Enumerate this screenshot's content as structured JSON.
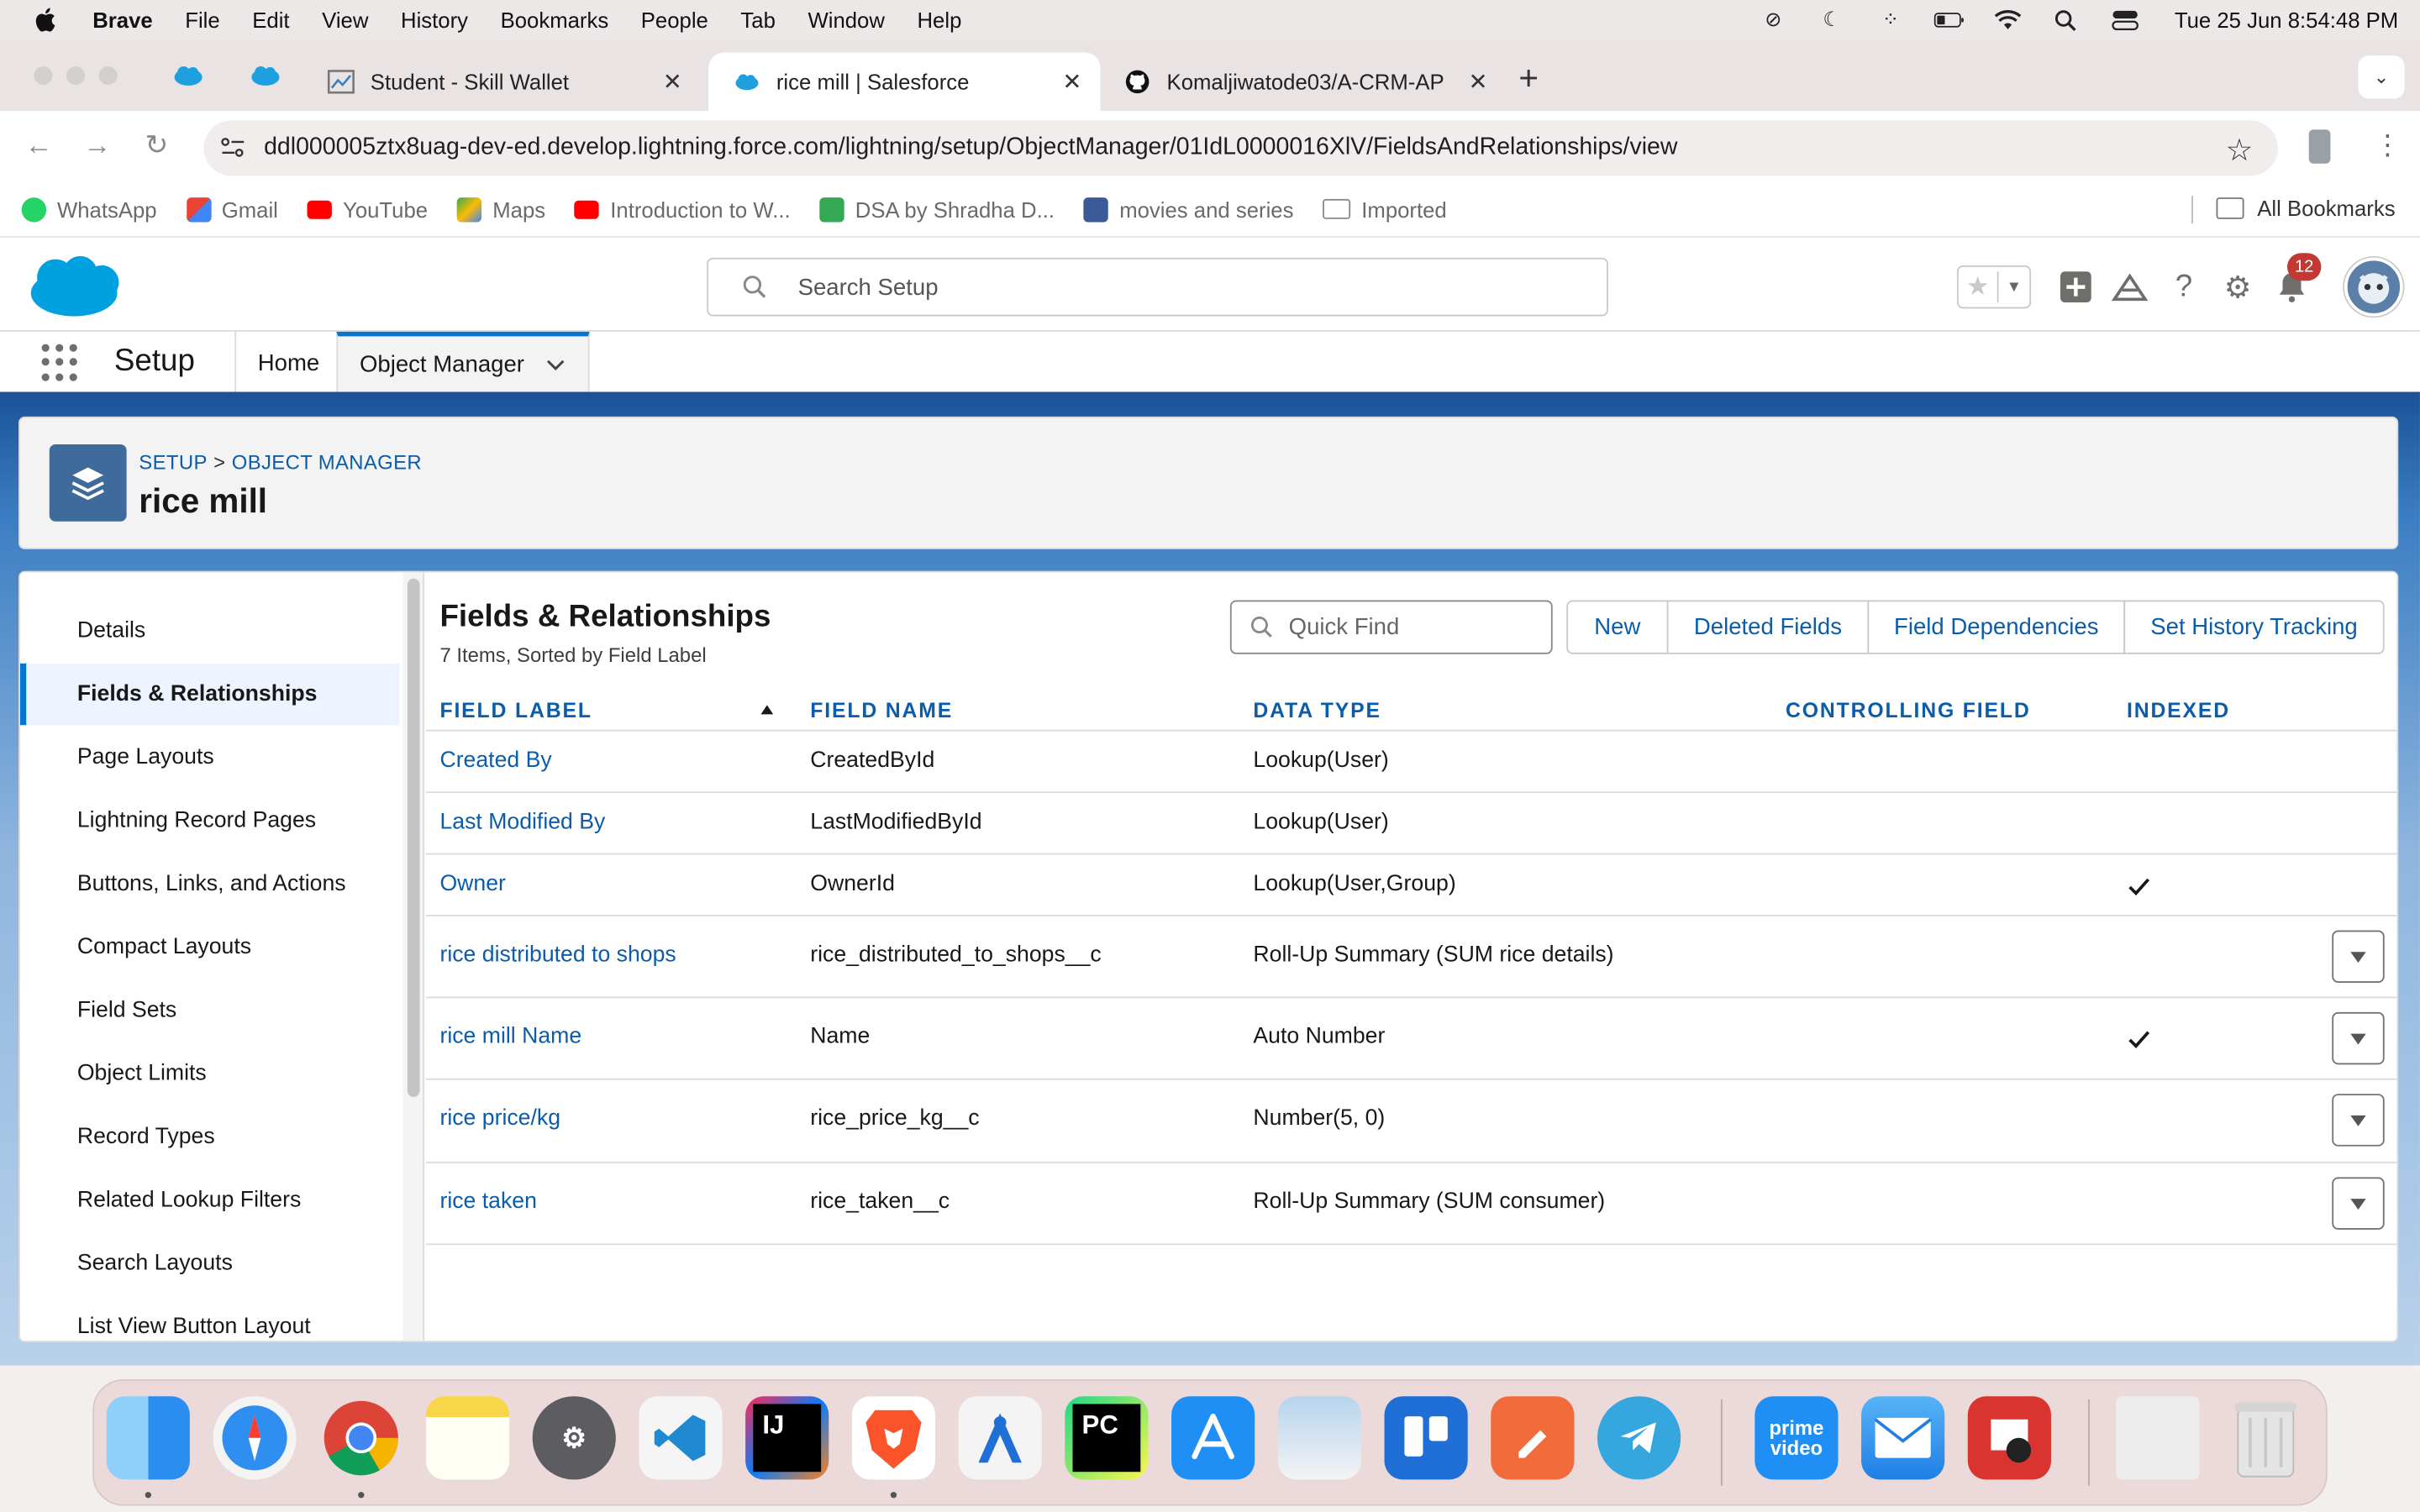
{
  "menubar": {
    "app": "Brave",
    "items": [
      "File",
      "Edit",
      "View",
      "History",
      "Bookmarks",
      "People",
      "Tab",
      "Window",
      "Help"
    ],
    "clock": "Tue 25 Jun  8:54:48 PM"
  },
  "tabs": [
    {
      "title": "Student - Skill Wallet",
      "active": false
    },
    {
      "title": "rice mill | Salesforce",
      "active": true
    },
    {
      "title": "Komaljiwatode03/A-CRM-API",
      "active": false
    }
  ],
  "address_bar": {
    "url": "ddl000005ztx8uag-dev-ed.develop.lightning.force.com/lightning/setup/ObjectManager/01IdL0000016XlV/FieldsAndRelationships/view"
  },
  "bookmarks": {
    "items": [
      {
        "label": "WhatsApp",
        "icon": "whatsapp-icon",
        "color": "#25d366"
      },
      {
        "label": "Gmail",
        "icon": "gmail-icon",
        "color": "#ea4335"
      },
      {
        "label": "YouTube",
        "icon": "youtube-icon",
        "color": "#ff0000"
      },
      {
        "label": "Maps",
        "icon": "maps-icon",
        "color": "#34a853"
      },
      {
        "label": "Introduction to W...",
        "icon": "youtube-icon",
        "color": "#ff0000"
      },
      {
        "label": "DSA by Shradha D...",
        "icon": "plus-square-icon",
        "color": "#34a853"
      },
      {
        "label": "movies and series",
        "icon": "bw-icon",
        "color": "#3d5a98"
      },
      {
        "label": "Imported",
        "icon": "folder-icon",
        "color": "#8a8a8a"
      }
    ],
    "all_label": "All Bookmarks"
  },
  "sf_header": {
    "search_placeholder": "Search Setup",
    "notification_count": "12",
    "brand_color": "#0176d3"
  },
  "sf_nav": {
    "app_name": "Setup",
    "home_label": "Home",
    "object_manager_label": "Object Manager"
  },
  "page_header": {
    "breadcrumb": [
      "SETUP",
      "OBJECT MANAGER"
    ],
    "title": "rice mill"
  },
  "sidebar": {
    "items": [
      {
        "label": "Details",
        "active": false
      },
      {
        "label": "Fields & Relationships",
        "active": true
      },
      {
        "label": "Page Layouts",
        "active": false
      },
      {
        "label": "Lightning Record Pages",
        "active": false
      },
      {
        "label": "Buttons, Links, and Actions",
        "active": false
      },
      {
        "label": "Compact Layouts",
        "active": false
      },
      {
        "label": "Field Sets",
        "active": false
      },
      {
        "label": "Object Limits",
        "active": false
      },
      {
        "label": "Record Types",
        "active": false
      },
      {
        "label": "Related Lookup Filters",
        "active": false
      },
      {
        "label": "Search Layouts",
        "active": false
      },
      {
        "label": "List View Button Layout",
        "active": false
      }
    ]
  },
  "fields": {
    "title": "Fields & Relationships",
    "subtitle": "7 Items, Sorted by Field Label",
    "quick_find_placeholder": "Quick Find",
    "buttons": [
      "New",
      "Deleted Fields",
      "Field Dependencies",
      "Set History Tracking"
    ],
    "columns": [
      "FIELD LABEL",
      "FIELD NAME",
      "DATA TYPE",
      "CONTROLLING FIELD",
      "INDEXED"
    ],
    "rows": [
      {
        "label": "Created By",
        "name": "CreatedById",
        "type": "Lookup(User)",
        "controlling": "",
        "indexed": false,
        "menu": false
      },
      {
        "label": "Last Modified By",
        "name": "LastModifiedById",
        "type": "Lookup(User)",
        "controlling": "",
        "indexed": false,
        "menu": false
      },
      {
        "label": "Owner",
        "name": "OwnerId",
        "type": "Lookup(User,Group)",
        "controlling": "",
        "indexed": true,
        "menu": false
      },
      {
        "label": "rice distributed to shops",
        "name": "rice_distributed_to_shops__c",
        "type": "Roll-Up Summary (SUM rice details)",
        "controlling": "",
        "indexed": false,
        "menu": true
      },
      {
        "label": "rice mill Name",
        "name": "Name",
        "type": "Auto Number",
        "controlling": "",
        "indexed": true,
        "menu": true
      },
      {
        "label": "rice price/kg",
        "name": "rice_price_kg__c",
        "type": "Number(5, 0)",
        "controlling": "",
        "indexed": false,
        "menu": true
      },
      {
        "label": "rice taken",
        "name": "rice_taken__c",
        "type": "Roll-Up Summary (SUM consumer)",
        "controlling": "",
        "indexed": false,
        "menu": true
      }
    ]
  },
  "dock": {
    "apps": [
      {
        "name": "finder-icon",
        "color": "#3ea2f5",
        "label": ""
      },
      {
        "name": "safari-icon",
        "color": "#2f8ff0",
        "label": ""
      },
      {
        "name": "chrome-icon",
        "color": "#e8e8e8",
        "label": ""
      },
      {
        "name": "notes-icon",
        "color": "#f7d64a",
        "label": ""
      },
      {
        "name": "system-settings-icon",
        "color": "#8e8e93",
        "label": ""
      },
      {
        "name": "vscode-icon",
        "color": "#f2f2f2",
        "label": ""
      },
      {
        "name": "intellij-icon",
        "color": "#1a1a1a",
        "label": "IJ"
      },
      {
        "name": "brave-icon",
        "color": "#ffffff",
        "label": ""
      },
      {
        "name": "instruments-icon",
        "color": "#f2f2f2",
        "label": ""
      },
      {
        "name": "pycharm-icon",
        "color": "#1a1a1a",
        "label": "PC"
      },
      {
        "name": "app-store-icon",
        "color": "#1f8ff5",
        "label": ""
      },
      {
        "name": "preview-icon",
        "color": "#d9e6f2",
        "label": ""
      },
      {
        "name": "trello-icon",
        "color": "#1f6fd6",
        "label": ""
      },
      {
        "name": "postman-icon",
        "color": "#f26b3a",
        "label": ""
      },
      {
        "name": "telegram-icon",
        "color": "#35a6de",
        "label": ""
      },
      {
        "name": "prime-video-icon",
        "color": "#1f8ff5",
        "label": "prime video"
      },
      {
        "name": "mail-icon",
        "color": "#3b9af0",
        "label": ""
      },
      {
        "name": "photo-booth-icon",
        "color": "#d9342f",
        "label": ""
      },
      {
        "name": "downloads-stack-icon",
        "color": "#e8e8e8",
        "label": ""
      },
      {
        "name": "trash-icon",
        "color": "#dcdcdc",
        "label": ""
      }
    ]
  }
}
